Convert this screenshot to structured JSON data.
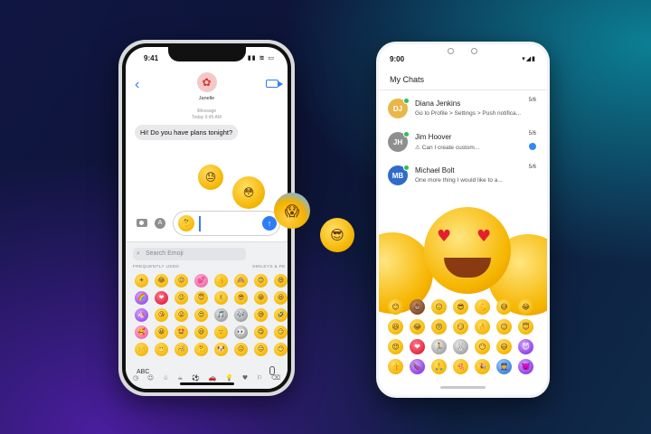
{
  "ios": {
    "status_time": "9:41",
    "contact_name": "Janelle",
    "service_label": "iMessage",
    "timestamp": "Today 9:45 AM",
    "incoming_message": "Hi! Do you have plans tonight?",
    "search_placeholder": "Search Emoji",
    "category_frequently_used": "FREQUENTLY USED",
    "category_smileys": "SMILEYS & PE",
    "abc_label": "ABC",
    "emoji_keys": [
      {
        "g": "☀",
        "c": ""
      },
      {
        "g": "😂",
        "c": ""
      },
      {
        "g": "😌",
        "c": ""
      },
      {
        "g": "💕",
        "c": "pink"
      },
      {
        "g": "👍",
        "c": ""
      },
      {
        "g": "🙈",
        "c": ""
      },
      {
        "g": "😊",
        "c": ""
      },
      {
        "g": "😄",
        "c": ""
      },
      {
        "g": "🌈",
        "c": "purple"
      },
      {
        "g": "❤",
        "c": "red"
      },
      {
        "g": "😉",
        "c": ""
      },
      {
        "g": "😇",
        "c": ""
      },
      {
        "g": "✌",
        "c": ""
      },
      {
        "g": "😎",
        "c": ""
      },
      {
        "g": "😁",
        "c": ""
      },
      {
        "g": "😆",
        "c": ""
      },
      {
        "g": "🦄",
        "c": "purple"
      },
      {
        "g": "😘",
        "c": ""
      },
      {
        "g": "😜",
        "c": ""
      },
      {
        "g": "😍",
        "c": ""
      },
      {
        "g": "🎵",
        "c": "gray"
      },
      {
        "g": "🎶",
        "c": "gray"
      },
      {
        "g": "😅",
        "c": ""
      },
      {
        "g": "🤣",
        "c": ""
      },
      {
        "g": "🥰",
        "c": "pink"
      },
      {
        "g": "😀",
        "c": ""
      },
      {
        "g": "🤩",
        "c": ""
      },
      {
        "g": "😃",
        "c": ""
      },
      {
        "g": "🙂",
        "c": ""
      },
      {
        "g": "👀",
        "c": "gray"
      },
      {
        "g": "😋",
        "c": ""
      },
      {
        "g": "😏",
        "c": ""
      },
      {
        "g": "🙌",
        "c": ""
      },
      {
        "g": "😬",
        "c": ""
      },
      {
        "g": "🥳",
        "c": ""
      },
      {
        "g": "🤔",
        "c": ""
      },
      {
        "g": "🐶",
        "c": ""
      },
      {
        "g": "😐",
        "c": ""
      },
      {
        "g": "😑",
        "c": ""
      },
      {
        "g": "😶",
        "c": ""
      }
    ],
    "category_bar_icons": [
      "◷",
      "☺",
      "♧",
      "☕",
      "⚽",
      "🚗",
      "💡",
      "♥",
      "⚐",
      "⌫"
    ]
  },
  "android": {
    "status_time": "9:00",
    "status_icons": "▾◢▮",
    "title": "My Chats",
    "chats": [
      {
        "name": "Diana Jenkins",
        "preview": "Go to Profile > Settings > Push notifica...",
        "date": "5/6",
        "unread": false,
        "avatar_color": "#e9b64a",
        "initials": "DJ"
      },
      {
        "name": "Jim Hoover",
        "preview": "⚠ Can I create custom...",
        "date": "5/6",
        "unread": true,
        "avatar_color": "#8f8f8f",
        "initials": "JH"
      },
      {
        "name": "Michael Bolt",
        "preview": "One more thing I would like to a...",
        "date": "5/6",
        "unread": false,
        "avatar_color": "#2f6cc9",
        "initials": "MB"
      }
    ],
    "emoji_keys": [
      {
        "g": "😊",
        "c": ""
      },
      {
        "g": "💩",
        "c": "brown"
      },
      {
        "g": "😐",
        "c": ""
      },
      {
        "g": "😎",
        "c": ""
      },
      {
        "g": "💪",
        "c": ""
      },
      {
        "g": "😅",
        "c": ""
      },
      {
        "g": "😂",
        "c": ""
      },
      {
        "g": "😆",
        "c": ""
      },
      {
        "g": "😂",
        "c": ""
      },
      {
        "g": "😠",
        "c": ""
      },
      {
        "g": "😏",
        "c": ""
      },
      {
        "g": "👌",
        "c": ""
      },
      {
        "g": "😉",
        "c": ""
      },
      {
        "g": "😇",
        "c": ""
      },
      {
        "g": "😍",
        "c": ""
      },
      {
        "g": "❤",
        "c": "red"
      },
      {
        "g": "🏃",
        "c": "gray"
      },
      {
        "g": "🐰",
        "c": "gray"
      },
      {
        "g": "😶",
        "c": ""
      },
      {
        "g": "😃",
        "c": ""
      },
      {
        "g": "😈",
        "c": "purple"
      },
      {
        "g": "👍",
        "c": ""
      },
      {
        "g": "🍆",
        "c": "purple"
      },
      {
        "g": "🙏",
        "c": ""
      },
      {
        "g": "🍕",
        "c": ""
      },
      {
        "g": "🎉",
        "c": ""
      },
      {
        "g": "👮",
        "c": "blue"
      },
      {
        "g": "👿",
        "c": "purple"
      }
    ]
  },
  "floating": {
    "screaming": "😱",
    "sunglasses": "😎",
    "sweat": "😓",
    "flushed": "😳",
    "thinking": "🤔"
  }
}
